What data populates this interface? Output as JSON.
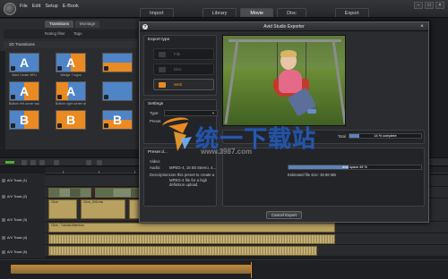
{
  "menu": [
    "File",
    "Edit",
    "Setup",
    "E-Book"
  ],
  "nav_tabs": [
    "Import",
    "Library",
    "Movie",
    "Disc",
    "Export"
  ],
  "library": {
    "tabs": [
      "Transitions",
      "Montage"
    ],
    "filter": "Rating filter",
    "tags": "Tags",
    "group": "2D Transitions",
    "thumbs": [
      {
        "letter": "A",
        "caption": "Slant Center BPU"
      },
      {
        "letter": "A",
        "caption": "Wedge 7 nigos"
      },
      {
        "letter": "",
        "caption": ""
      },
      {
        "letter": "A",
        "caption": "Bottom left corner wipe"
      },
      {
        "letter": "A",
        "caption": "Bottom right corner wipe"
      },
      {
        "letter": "",
        "caption": ""
      },
      {
        "letter": "B",
        "caption": ""
      },
      {
        "letter": "B",
        "caption": ""
      },
      {
        "letter": "B",
        "caption": ""
      }
    ]
  },
  "dialog": {
    "title": "Avid Studio Exporter",
    "export_type": {
      "heading": "Export type",
      "options": [
        {
          "label": "File",
          "selected": false
        },
        {
          "label": "Disc",
          "selected": false
        },
        {
          "label": "Web",
          "selected": true
        }
      ]
    },
    "settings": {
      "heading": "Settings",
      "type_label": "Type:",
      "type_value": "",
      "preset_label": "Preset"
    },
    "preset_details": {
      "heading": "Preset d...",
      "video_label": "Video:",
      "video_value": "",
      "audio_label": "Audio:",
      "audio_value": "MPEG-4, 16 Bit Stereo, 4...",
      "description_label": "Description:",
      "description_value": "Use this preset to create a MPEG-4 file for a high definition upload."
    },
    "progress_total": {
      "label": "Total",
      "text": "14 % complete",
      "percent": 14
    },
    "progress_disk": {
      "text": "disk space 45 %",
      "percent": 45
    },
    "estimated_size": "Estimated file size: 39.98 MB",
    "cancel_label": "Cancel Export"
  },
  "timeline": {
    "tracks": [
      "A/V Track (1)",
      "A/V Track (2)",
      "A/V Track (3)",
      "A/V Track (4)",
      "A/V Track (5)"
    ],
    "clips": {
      "clip_a": "Clive",
      "clip_b": "Clive_006.mts",
      "clip_c": "Clive - Tutorial Attention"
    }
  },
  "watermark": {
    "chinese": "统一下载站",
    "url": "www.3987.com"
  },
  "colors": {
    "accent": "#e98a22",
    "progress": "#5d83b8",
    "dialog_bg": "#2b2c30"
  }
}
